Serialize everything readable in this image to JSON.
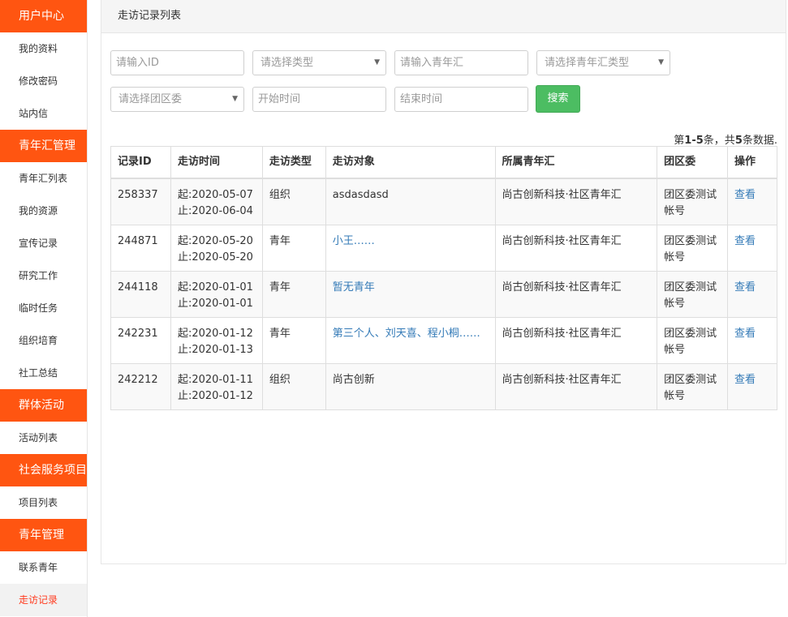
{
  "sidebar": {
    "sections": [
      {
        "title": "用户中心",
        "items": [
          "我的资料",
          "修改密码",
          "站内信"
        ]
      },
      {
        "title": "青年汇管理",
        "items": [
          "青年汇列表",
          "我的资源",
          "宣传记录",
          "研究工作",
          "临时任务",
          "组织培育",
          "社工总结"
        ]
      },
      {
        "title": "群体活动",
        "items": [
          "活动列表"
        ]
      },
      {
        "title": "社会服务项目",
        "items": [
          "项目列表"
        ]
      },
      {
        "title": "青年管理",
        "items": [
          "联系青年",
          "走访记录"
        ]
      }
    ],
    "active_item": "走访记录"
  },
  "panel": {
    "title": "走访记录列表"
  },
  "filters": {
    "id_placeholder": "请输入ID",
    "type_select": "请选择类型",
    "youth_club_placeholder": "请输入青年汇",
    "club_type_select": "请选择青年汇类型",
    "committee_select": "请选择团区委",
    "start_placeholder": "开始时间",
    "end_placeholder": "结束时间",
    "search_label": "搜索"
  },
  "summary": {
    "prefix": "第",
    "range": "1-5",
    "mid": "条，共",
    "total": "5",
    "suffix": "条数据."
  },
  "table": {
    "headers": [
      "记录ID",
      "走访时间",
      "走访类型",
      "走访对象",
      "所属青年汇",
      "团区委",
      "操作"
    ],
    "rows": [
      {
        "id": "258337",
        "start": "起:2020-05-07",
        "end": "止:2020-06-04",
        "type": "组织",
        "target": "asdasdasd",
        "target_link": false,
        "club": "尚古创新科技·社区青年汇",
        "committee": "团区委测试帐号",
        "action": "查看"
      },
      {
        "id": "244871",
        "start": "起:2020-05-20",
        "end": "止:2020-05-20",
        "type": "青年",
        "target": "小王……",
        "target_link": true,
        "club": "尚古创新科技·社区青年汇",
        "committee": "团区委测试帐号",
        "action": "查看"
      },
      {
        "id": "244118",
        "start": "起:2020-01-01",
        "end": "止:2020-01-01",
        "type": "青年",
        "target": "暂无青年",
        "target_link": true,
        "club": "尚古创新科技·社区青年汇",
        "committee": "团区委测试帐号",
        "action": "查看"
      },
      {
        "id": "242231",
        "start": "起:2020-01-12",
        "end": "止:2020-01-13",
        "type": "青年",
        "target": "第三个人、刘天喜、程小桐……",
        "target_link": true,
        "club": "尚古创新科技·社区青年汇",
        "committee": "团区委测试帐号",
        "action": "查看"
      },
      {
        "id": "242212",
        "start": "起:2020-01-11",
        "end": "止:2020-01-12",
        "type": "组织",
        "target": "尚古创新",
        "target_link": false,
        "club": "尚古创新科技·社区青年汇",
        "committee": "团区委测试帐号",
        "action": "查看"
      }
    ]
  },
  "colors": {
    "accent": "#ff5511",
    "active_text": "#ff3b1f",
    "search_button": "#4cbd62",
    "link": "#337ab7"
  }
}
